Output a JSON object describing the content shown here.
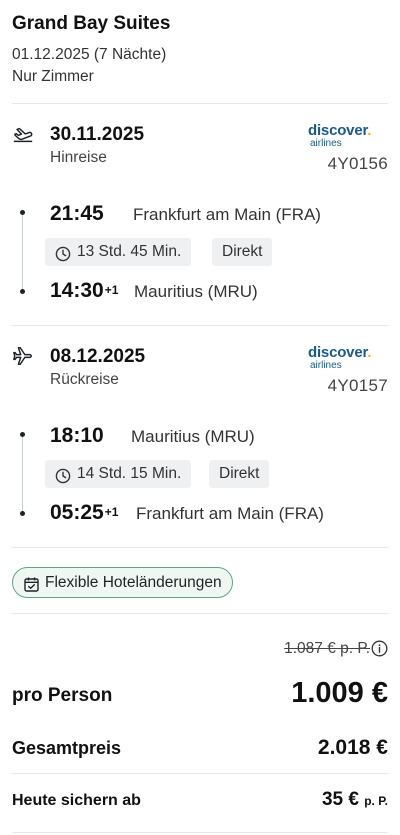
{
  "hotel": {
    "name": "Grand Bay Suites",
    "dates": "01.12.2025 (7 Nächte)",
    "board": "Nur Zimmer"
  },
  "flights": [
    {
      "date": "30.11.2025",
      "direction": "Hinreise",
      "airline_brand": "discover",
      "airline_sub": "airlines",
      "flight_number": "4Y0156",
      "departure_time": "21:45",
      "departure_place": "Frankfurt am Main (FRA)",
      "duration": "13 Std. 45 Min.",
      "stops": "Direkt",
      "arrival_time": "14:30",
      "arrival_offset": "+1",
      "arrival_place": "Mauritius (MRU)"
    },
    {
      "date": "08.12.2025",
      "direction": "Rückreise",
      "airline_brand": "discover",
      "airline_sub": "airlines",
      "flight_number": "4Y0157",
      "departure_time": "18:10",
      "departure_place": "Mauritius (MRU)",
      "duration": "14 Std. 15 Min.",
      "stops": "Direkt",
      "arrival_time": "05:25",
      "arrival_offset": "+1",
      "arrival_place": "Frankfurt am Main (FRA)"
    }
  ],
  "flex_badge": "Flexible Hoteländerungen",
  "pricing": {
    "old_price": "1.087 € p. P.",
    "per_person_label": "pro Person",
    "per_person_value": "1.009 €",
    "total_label": "Gesamtpreis",
    "total_value": "2.018 €",
    "deposit_label": "Heute sichern ab",
    "deposit_value": "35 €",
    "deposit_suffix": "p. P."
  },
  "colors": {
    "brand_blue": "#1b5a8a",
    "brand_yellow": "#f5b400",
    "badge_border": "#5fa487",
    "badge_bg": "#eef7f1",
    "chip_bg": "#eef0f2"
  },
  "icons": {
    "outbound": "plane-takeoff-icon",
    "return": "plane-landing-icon",
    "duration": "clock-icon",
    "badge": "calendar-check-icon",
    "info": "info-icon"
  }
}
